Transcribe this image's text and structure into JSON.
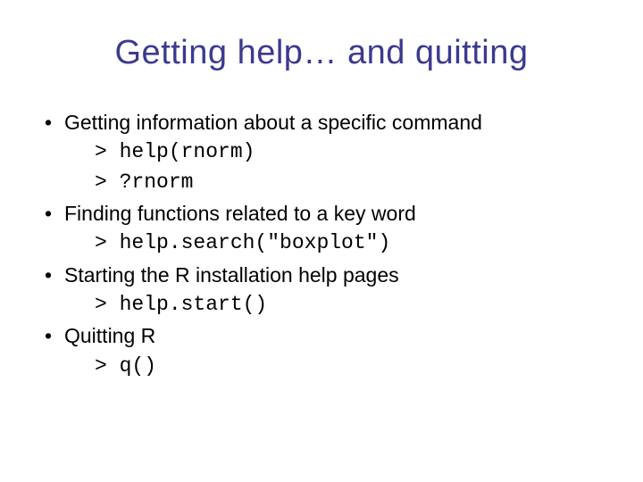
{
  "title": "Getting help… and quitting",
  "items": [
    {
      "text": "Getting information about a specific command",
      "code": [
        "> help(rnorm)",
        "> ?rnorm"
      ]
    },
    {
      "text": "Finding functions related to a key word",
      "code": [
        "> help.search(\"boxplot\")"
      ]
    },
    {
      "text": "Starting the R installation help pages",
      "code": [
        "> help.start()"
      ]
    },
    {
      "text": "Quitting R",
      "code": [
        "> q()"
      ]
    }
  ]
}
